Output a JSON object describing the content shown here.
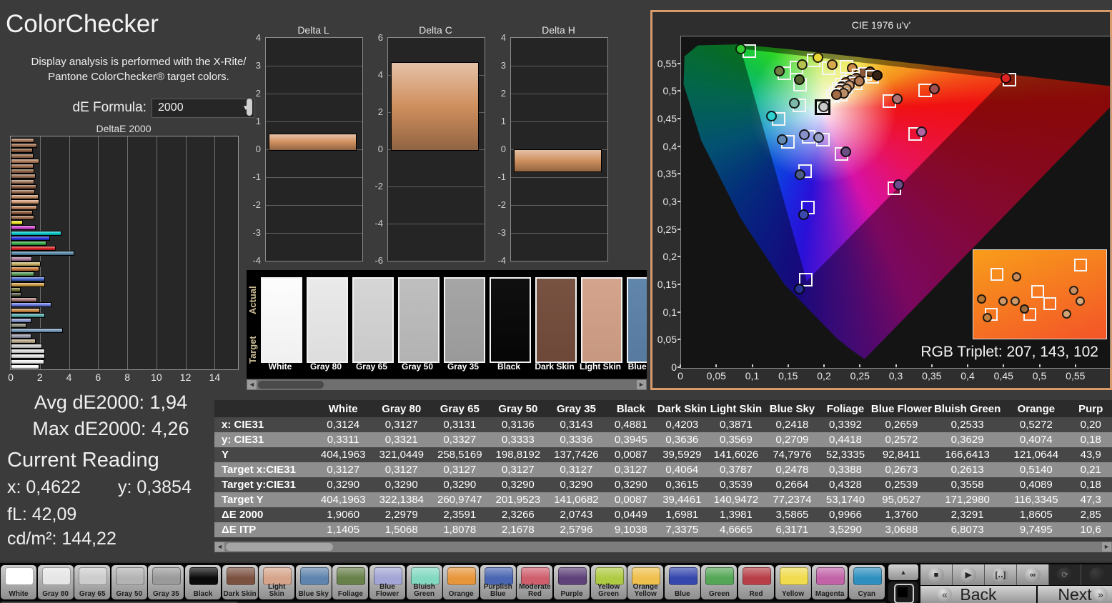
{
  "header": {
    "title": "ColorChecker",
    "desc_line1": "Display analysis is performed with the X-Rite/",
    "desc_line2": "Pantone ColorChecker® target colors.",
    "formula_label": "dE Formula:",
    "formula_value": "2000"
  },
  "stats": {
    "avg": "Avg dE2000: 1,94",
    "max": "Max dE2000: 4,26",
    "current_heading": "Current Reading",
    "x": "x: 0,4622",
    "y": "y: 0,3854",
    "fl": "fL: 42,09",
    "cd": "cd/m²: 144,22"
  },
  "strip": {
    "actual_label": "Actual",
    "target_label": "Target",
    "swatches": [
      {
        "name": "White",
        "color": "#fdfdfd"
      },
      {
        "name": "Gray 80",
        "color": "#e9e9e9"
      },
      {
        "name": "Gray 65",
        "color": "#d4d4d4"
      },
      {
        "name": "Gray 50",
        "color": "#bcbcbc"
      },
      {
        "name": "Gray 35",
        "color": "#a2a2a2"
      },
      {
        "name": "Black",
        "color": "#060606"
      },
      {
        "name": "Dark Skin",
        "color": "#734b3a"
      },
      {
        "name": "Light Skin",
        "color": "#d2a087"
      },
      {
        "name": "Blue Sky",
        "color": "#5b81a8"
      }
    ]
  },
  "cie": {
    "title": "CIE 1976 u'v'",
    "rgb_label": "RGB Triplet: 207, 143, 102",
    "y_ticks": [
      "0,55",
      "0,5",
      "0,45",
      "0,4",
      "0,35",
      "0,3",
      "0,25",
      "0,2",
      "0,15",
      "0,1",
      "0,05",
      "0"
    ],
    "x_ticks": [
      "0",
      "0,05",
      "0,1",
      "0,15",
      "0,2",
      "0,25",
      "0,3",
      "0,35",
      "0,4",
      "0,45",
      "0,5",
      "0,55"
    ]
  },
  "chart_data": {
    "deltae2000": {
      "type": "bar",
      "title": "DeltaE 2000",
      "orientation": "horizontal",
      "xlim": [
        0,
        15.5
      ],
      "x_ticks": [
        0,
        2,
        4,
        6,
        8,
        10,
        12,
        14
      ],
      "bars": [
        {
          "color": "#a87757",
          "value": 1.5
        },
        {
          "color": "#9b6b4a",
          "value": 1.7
        },
        {
          "color": "#8a5c3e",
          "value": 1.4
        },
        {
          "color": "#96684a",
          "value": 1.45
        },
        {
          "color": "#b07c58",
          "value": 1.85
        },
        {
          "color": "#a06c4c",
          "value": 1.45
        },
        {
          "color": "#8e5f41",
          "value": 1.5
        },
        {
          "color": "#9c6e50",
          "value": 1.6
        },
        {
          "color": "#a4765a",
          "value": 1.5
        },
        {
          "color": "#8a5a3c",
          "value": 1.65
        },
        {
          "color": "#926448",
          "value": 1.55
        },
        {
          "color": "#c08a64",
          "value": 1.8
        },
        {
          "color": "#d49870",
          "value": 1.85
        },
        {
          "color": "#b8805c",
          "value": 1.7
        },
        {
          "color": "#885838",
          "value": 1.4
        },
        {
          "color": "#9a6a4a",
          "value": 1.5
        },
        {
          "color": "#e8e020",
          "value": 0.75
        },
        {
          "color": "#cc44cc",
          "value": 1.6
        },
        {
          "color": "#00c8c8",
          "value": 3.4
        },
        {
          "color": "#2233dd",
          "value": 2.6
        },
        {
          "color": "#33aa44",
          "value": 2.35
        },
        {
          "color": "#dd2222",
          "value": 3.0
        },
        {
          "color": "#5588aa",
          "value": 4.26
        },
        {
          "color": "#aa7799",
          "value": 1.35
        },
        {
          "color": "#c8b060",
          "value": 1.95
        },
        {
          "color": "#cc7733",
          "value": 1.85
        },
        {
          "color": "#559955",
          "value": 1.5
        },
        {
          "color": "#4466cc",
          "value": 2.25
        },
        {
          "color": "#cc9944",
          "value": 2.25
        },
        {
          "color": "#777733",
          "value": 0.6
        },
        {
          "color": "#555544",
          "value": 0.65
        },
        {
          "color": "#aa7777",
          "value": 1.7
        },
        {
          "color": "#6677dd",
          "value": 2.7
        },
        {
          "color": "#cc8844",
          "value": 1.9
        },
        {
          "color": "#55aaaa",
          "value": 2.25
        },
        {
          "color": "#8899cc",
          "value": 1.3
        },
        {
          "color": "#888877",
          "value": 1.0
        },
        {
          "color": "#7799bb",
          "value": 3.5
        },
        {
          "color": "#9999aa",
          "value": 1.3
        },
        {
          "color": "#bbaa88",
          "value": 1.6
        },
        {
          "color": "#cccccc",
          "value": 2.05
        },
        {
          "color": "#dddddd",
          "value": 2.25
        },
        {
          "color": "#e5e5e5",
          "value": 2.25
        },
        {
          "color": "#eeeeee",
          "value": 2.2
        },
        {
          "color": "#f8f8f8",
          "value": 1.85
        }
      ]
    },
    "delta_lch": [
      {
        "type": "bar",
        "title": "Delta L",
        "ylim": [
          -4,
          4
        ],
        "ticks": [
          4,
          3,
          2,
          1,
          0,
          -1,
          -2,
          -3,
          -4
        ],
        "value": 0.57
      },
      {
        "type": "bar",
        "title": "Delta C",
        "ylim": [
          -6,
          6
        ],
        "ticks": [
          6,
          4,
          2,
          0,
          -2,
          -4,
          -6
        ],
        "value": 4.7
      },
      {
        "type": "bar",
        "title": "Delta H",
        "ylim": [
          -4,
          4
        ],
        "ticks": [
          4,
          3,
          2,
          1,
          0,
          -1,
          -2,
          -3,
          -4
        ],
        "value": -0.78
      }
    ],
    "cie_scatter": {
      "type": "scatter",
      "title": "CIE 1976 u'v'",
      "x_range": [
        0,
        0.597
      ],
      "y_range": [
        0,
        0.6
      ],
      "triangle_gamut_uv": [
        [
          0.083,
          0.578
        ],
        [
          0.451,
          0.523
        ],
        [
          0.175,
          0.157
        ]
      ],
      "points": [
        [
          0.083,
          0.578,
          0.094,
          0.5745,
          "#33cc33",
          0
        ],
        [
          0.19,
          0.5625,
          0.184,
          0.558,
          "#e8d835",
          0
        ],
        [
          0.168,
          0.549,
          0.16,
          0.545,
          "#b5c24d",
          0
        ],
        [
          0.136,
          0.5375,
          0.1435,
          0.5335,
          "#6f7d42",
          0
        ],
        [
          0.164,
          0.523,
          0.165,
          0.5135,
          "#53622f",
          0
        ],
        [
          0.21,
          0.549,
          0.2045,
          0.5435,
          "#d8a94c",
          0
        ],
        [
          0.2375,
          0.5435,
          0.2295,
          0.5455,
          "#cd8a45",
          0
        ],
        [
          0.2525,
          0.535,
          0.2465,
          0.53,
          "#8a5a3a",
          0
        ],
        [
          0.2625,
          0.5365,
          0.2555,
          0.5325,
          "#6e4426",
          0
        ],
        [
          0.2435,
          0.5255,
          0.237,
          0.5235,
          "#9a6643",
          0
        ],
        [
          0.236,
          0.5215,
          0.231,
          0.518,
          "#aa7654",
          0
        ],
        [
          0.2475,
          0.5205,
          0.2425,
          0.5165,
          "#b27a50",
          0
        ],
        [
          0.2285,
          0.5175,
          0.2225,
          0.5135,
          "#c28a5e",
          0
        ],
        [
          0.2335,
          0.5125,
          0.2285,
          0.5095,
          "#d39b6f",
          0
        ],
        [
          0.2225,
          0.5095,
          0.2185,
          0.5055,
          "#8a5a3e",
          0
        ],
        [
          0.2295,
          0.5055,
          0.2245,
          0.5025,
          "#caa077",
          0
        ],
        [
          0.2195,
          0.5025,
          0.2145,
          0.4995,
          "#e2ab81",
          0
        ],
        [
          0.2255,
          0.4985,
          0.2215,
          0.4955,
          "#ba8c66",
          0
        ],
        [
          0.2155,
          0.4955,
          0.2105,
          0.4925,
          "#a26c46",
          0
        ],
        [
          0.2725,
          0.5305,
          0.2655,
          0.5275,
          "#362115",
          0
        ],
        [
          0.4515,
          0.5255,
          0.4565,
          0.522,
          "#dd2222",
          0
        ],
        [
          0.3525,
          0.5055,
          0.3395,
          0.5025,
          "#9e4f4f",
          0
        ],
        [
          0.3005,
          0.4875,
          0.2895,
          0.4835,
          "#b07272",
          0
        ],
        [
          0.1975,
          0.4735,
          0.197,
          0.4715,
          "#c9c9c9",
          1
        ],
        [
          0.157,
          0.4795,
          0.164,
          0.4755,
          "#7cb9a9",
          0
        ],
        [
          0.1255,
          0.456,
          0.135,
          0.4515,
          "#2fd0d0",
          0
        ],
        [
          0.1715,
          0.4225,
          0.1775,
          0.4185,
          "#8a92ca",
          0
        ],
        [
          0.1905,
          0.4175,
          0.1965,
          0.4135,
          "#9aa2cb",
          0
        ],
        [
          0.1405,
          0.4135,
          0.1485,
          0.4105,
          "#6289b2",
          0
        ],
        [
          0.2285,
          0.3915,
          0.2225,
          0.3875,
          "#6b4f85",
          0
        ],
        [
          0.1655,
          0.3505,
          0.172,
          0.3565,
          "#4b5b8c",
          0
        ],
        [
          0.334,
          0.4285,
          0.3255,
          0.4245,
          "#b263a3",
          0
        ],
        [
          0.3025,
          0.3325,
          0.2965,
          0.326,
          "#6f4e90",
          0
        ],
        [
          0.1705,
          0.2785,
          0.1765,
          0.2915,
          "#3a49ac",
          0
        ],
        [
          0.1645,
          0.1435,
          0.1735,
          0.1605,
          "#262e8e",
          0
        ]
      ],
      "inset": {
        "squares": [
          [
            17,
            27
          ],
          [
            80,
            16
          ],
          [
            48,
            46
          ],
          [
            57,
            60
          ],
          [
            13,
            72
          ],
          [
            42,
            72
          ]
        ],
        "circles": [
          [
            32,
            30
          ],
          [
            75,
            45
          ],
          [
            6,
            55
          ],
          [
            22,
            57
          ],
          [
            31,
            57
          ],
          [
            38,
            66
          ],
          [
            70,
            72
          ],
          [
            80,
            57
          ],
          [
            10,
            76
          ]
        ],
        "circle_colors": [
          "#c98c5a",
          "#c88f63",
          "#b5762f",
          "#cf9a6a",
          "#cf9a6a",
          "#9a6a3a",
          "#d3a273",
          "#d7a97e",
          "#c0803f"
        ]
      }
    }
  },
  "table": {
    "columns": [
      "",
      "White",
      "Gray 80",
      "Gray 65",
      "Gray 50",
      "Gray 35",
      "Black",
      "Dark Skin",
      "Light Skin",
      "Blue Sky",
      "Foliage",
      "Blue Flower",
      "Bluish Green",
      "Orange",
      "Purp"
    ],
    "rows": [
      {
        "label": "x: CIE31",
        "values": [
          "0,3124",
          "0,3127",
          "0,3131",
          "0,3136",
          "0,3143",
          "0,4881",
          "0,4203",
          "0,3871",
          "0,2418",
          "0,3392",
          "0,2659",
          "0,2533",
          "0,5272",
          "0,20"
        ]
      },
      {
        "label": "y: CIE31",
        "values": [
          "0,3311",
          "0,3321",
          "0,3327",
          "0,3333",
          "0,3336",
          "0,3945",
          "0,3636",
          "0,3569",
          "0,2709",
          "0,4418",
          "0,2572",
          "0,3629",
          "0,4074",
          "0,18"
        ]
      },
      {
        "label": "Y",
        "values": [
          "404,1963",
          "321,0449",
          "258,5169",
          "198,8192",
          "137,7426",
          "0,0087",
          "39,5929",
          "141,6026",
          "74,7976",
          "52,3335",
          "92,8411",
          "166,6413",
          "121,0644",
          "43,9"
        ]
      },
      {
        "label": "Target x:CIE31",
        "values": [
          "0,3127",
          "0,3127",
          "0,3127",
          "0,3127",
          "0,3127",
          "0,3127",
          "0,4064",
          "0,3787",
          "0,2478",
          "0,3388",
          "0,2673",
          "0,2613",
          "0,5140",
          "0,21"
        ]
      },
      {
        "label": "Target y:CIE31",
        "values": [
          "0,3290",
          "0,3290",
          "0,3290",
          "0,3290",
          "0,3290",
          "0,3290",
          "0,3615",
          "0,3539",
          "0,2664",
          "0,4328",
          "0,2539",
          "0,3558",
          "0,4089",
          "0,18"
        ]
      },
      {
        "label": "Target Y",
        "values": [
          "404,1963",
          "322,1384",
          "260,9747",
          "201,9523",
          "141,0682",
          "0,0087",
          "39,4461",
          "140,9472",
          "77,2374",
          "53,1740",
          "95,0527",
          "171,2980",
          "116,3345",
          "47,3"
        ]
      },
      {
        "label": "ΔE 2000",
        "values": [
          "1,9060",
          "2,2979",
          "2,3591",
          "2,3266",
          "2,0743",
          "0,0449",
          "1,6981",
          "1,3981",
          "3,5865",
          "0,9966",
          "1,3760",
          "2,3291",
          "1,8605",
          "2,85"
        ]
      },
      {
        "label": "ΔE ITP",
        "values": [
          "1,1405",
          "1,5068",
          "1,8078",
          "2,1678",
          "2,5796",
          "9,1038",
          "7,3375",
          "4,6665",
          "6,3171",
          "3,5290",
          "3,0688",
          "6,8073",
          "9,7495",
          "10,6"
        ]
      }
    ]
  },
  "toolbar": {
    "swatches": [
      {
        "name": "White",
        "color": "#ffffff"
      },
      {
        "name": "Gray 80",
        "color": "#e6e6e6"
      },
      {
        "name": "Gray 65",
        "color": "#cdcdcd"
      },
      {
        "name": "Gray 50",
        "color": "#b3b3b3"
      },
      {
        "name": "Gray 35",
        "color": "#9a9a9a"
      },
      {
        "name": "Black",
        "color": "#0a0a0a"
      },
      {
        "name": "Dark Skin",
        "color": "#7b5140"
      },
      {
        "name": "Light Skin",
        "color": "#d6a48b"
      },
      {
        "name": "Blue Sky",
        "color": "#5f84ad"
      },
      {
        "name": "Foliage",
        "color": "#68804a"
      },
      {
        "name": "Blue Flower",
        "color": "#a2a5d5"
      },
      {
        "name": "Bluish Green",
        "color": "#82d9c0"
      },
      {
        "name": "Orange",
        "color": "#e8963c"
      },
      {
        "name": "Purplish Blue",
        "color": "#4a66b2"
      },
      {
        "name": "Moderate Red",
        "color": "#cf5f6d"
      },
      {
        "name": "Purple",
        "color": "#5e4178"
      },
      {
        "name": "Yellow Green",
        "color": "#afcb43"
      },
      {
        "name": "Orange Yellow",
        "color": "#efc04e"
      },
      {
        "name": "Blue",
        "color": "#3648ae"
      },
      {
        "name": "Green",
        "color": "#55a757"
      },
      {
        "name": "Red",
        "color": "#b83f47"
      },
      {
        "name": "Yellow",
        "color": "#f0dc4e"
      },
      {
        "name": "Magenta",
        "color": "#c263a8"
      },
      {
        "name": "Cyan",
        "color": "#2f90bf"
      }
    ],
    "transport": [
      "stop",
      "play",
      "loop",
      "infinity",
      "refresh",
      "blank"
    ],
    "up_icon": "▲",
    "back": "Back",
    "next": "Next",
    "back_chevron": "«",
    "next_chevron": "»"
  },
  "colors": {
    "accent_border": "#d99a6b",
    "panel_bg": "#3b3b3b",
    "chart_bg": "#272727",
    "row_dark": "#474747",
    "row_light": "#8e8e8e"
  }
}
